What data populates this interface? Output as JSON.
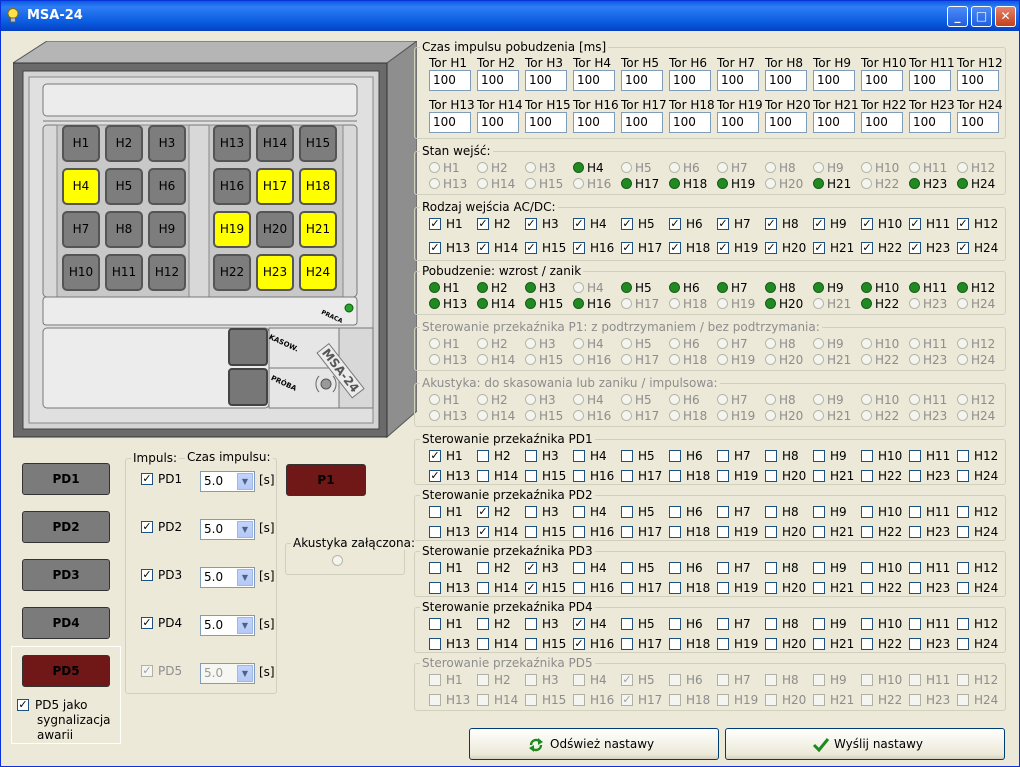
{
  "window": {
    "title": "MSA-24",
    "minimize": "_",
    "maximize": "□",
    "close": "✕"
  },
  "device": {
    "logo": "MSA-24",
    "praca": "PRACA",
    "kasow": "KASOW.",
    "proba": "PRÓBA",
    "left_buttons": [
      {
        "label": "H1",
        "on": false
      },
      {
        "label": "H2",
        "on": false
      },
      {
        "label": "H3",
        "on": false
      },
      {
        "label": "H4",
        "on": true
      },
      {
        "label": "H5",
        "on": false
      },
      {
        "label": "H6",
        "on": false
      },
      {
        "label": "H7",
        "on": false
      },
      {
        "label": "H8",
        "on": false
      },
      {
        "label": "H9",
        "on": false
      },
      {
        "label": "H10",
        "on": false
      },
      {
        "label": "H11",
        "on": false
      },
      {
        "label": "H12",
        "on": false
      }
    ],
    "right_buttons": [
      {
        "label": "H13",
        "on": false
      },
      {
        "label": "H14",
        "on": false
      },
      {
        "label": "H15",
        "on": false
      },
      {
        "label": "H16",
        "on": false
      },
      {
        "label": "H17",
        "on": true
      },
      {
        "label": "H18",
        "on": true
      },
      {
        "label": "H19",
        "on": true
      },
      {
        "label": "H20",
        "on": false
      },
      {
        "label": "H21",
        "on": true
      },
      {
        "label": "H22",
        "on": false
      },
      {
        "label": "H23",
        "on": true
      },
      {
        "label": "H24",
        "on": true
      }
    ]
  },
  "pd_buttons": [
    {
      "label": "PD1",
      "red": false
    },
    {
      "label": "PD2",
      "red": false
    },
    {
      "label": "PD3",
      "red": false
    },
    {
      "label": "PD4",
      "red": false
    },
    {
      "label": "PD5",
      "red": true
    }
  ],
  "impuls": {
    "impuls_label": "Impuls:",
    "czas_label": "Czas impulsu:",
    "unit": "[s]",
    "rows": [
      {
        "label": "PD1",
        "checked": true,
        "value": "5.0",
        "disabled": false
      },
      {
        "label": "PD2",
        "checked": true,
        "value": "5.0",
        "disabled": false
      },
      {
        "label": "PD3",
        "checked": true,
        "value": "5.0",
        "disabled": false
      },
      {
        "label": "PD4",
        "checked": true,
        "value": "5.0",
        "disabled": false
      },
      {
        "label": "PD5",
        "checked": true,
        "value": "5.0",
        "disabled": true
      }
    ]
  },
  "p1_button": "P1",
  "akustyka_zalaczona": "Akustyka załączona:",
  "pd5_alarm": {
    "line1": "PD5 jako",
    "line2": "sygnalizacja",
    "line3": "awarii",
    "checked": true
  },
  "czas_impulsu": {
    "title": "Czas impulsu pobudzenia [ms]",
    "tracks": [
      "Tor H1",
      "Tor H2",
      "Tor H3",
      "Tor H4",
      "Tor H5",
      "Tor H6",
      "Tor H7",
      "Tor H8",
      "Tor H9",
      "Tor H10",
      "Tor H11",
      "Tor H12",
      "Tor H13",
      "Tor H14",
      "Tor H15",
      "Tor H16",
      "Tor H17",
      "Tor H18",
      "Tor H19",
      "Tor H20",
      "Tor H21",
      "Tor H22",
      "Tor H23",
      "Tor H24"
    ],
    "values": [
      "100",
      "100",
      "100",
      "100",
      "100",
      "100",
      "100",
      "100",
      "100",
      "100",
      "100",
      "100",
      "100",
      "100",
      "100",
      "100",
      "100",
      "100",
      "100",
      "100",
      "100",
      "100",
      "100",
      "100"
    ]
  },
  "channels": [
    "H1",
    "H2",
    "H3",
    "H4",
    "H5",
    "H6",
    "H7",
    "H8",
    "H9",
    "H10",
    "H11",
    "H12",
    "H13",
    "H14",
    "H15",
    "H16",
    "H17",
    "H18",
    "H19",
    "H20",
    "H21",
    "H22",
    "H23",
    "H24"
  ],
  "groups": [
    {
      "title": "Stan wejść:",
      "kind": "radio",
      "disabled": false,
      "on": [
        4,
        17,
        18,
        19,
        21,
        23,
        24
      ],
      "dis": [
        1,
        2,
        3,
        5,
        6,
        7,
        8,
        9,
        10,
        11,
        12,
        13,
        14,
        15,
        16,
        20,
        22
      ]
    },
    {
      "title": "Rodzaj wejścia AC/DC:",
      "kind": "check",
      "disabled": false,
      "on": [
        1,
        2,
        3,
        4,
        5,
        6,
        7,
        8,
        9,
        10,
        11,
        12,
        13,
        14,
        15,
        16,
        17,
        18,
        19,
        20,
        21,
        22,
        23,
        24
      ],
      "dis": []
    },
    {
      "title": "Pobudzenie:  wzrost / zanik",
      "kind": "radio",
      "disabled": false,
      "on": [
        1,
        2,
        3,
        5,
        6,
        7,
        8,
        9,
        10,
        11,
        12,
        13,
        14,
        15,
        16,
        20,
        22
      ],
      "dis": [
        4,
        17,
        18,
        19,
        21,
        23,
        24
      ]
    },
    {
      "title": "Sterowanie przekaźnika P1:  z podtrzymaniem / bez podtrzymania:",
      "kind": "radio",
      "disabled": true,
      "on": [],
      "dis": [
        1,
        2,
        3,
        4,
        5,
        6,
        7,
        8,
        9,
        10,
        11,
        12,
        13,
        14,
        15,
        16,
        17,
        18,
        19,
        20,
        21,
        22,
        23,
        24
      ]
    },
    {
      "title": "Akustyka: do skasowania lub zaniku / impulsowa:",
      "kind": "radio",
      "disabled": true,
      "on": [],
      "dis": [
        1,
        2,
        3,
        4,
        5,
        6,
        7,
        8,
        9,
        10,
        11,
        12,
        13,
        14,
        15,
        16,
        17,
        18,
        19,
        20,
        21,
        22,
        23,
        24
      ]
    },
    {
      "title": "Sterowanie przekaźnika PD1",
      "kind": "check",
      "disabled": false,
      "on": [
        1,
        13
      ],
      "dis": []
    },
    {
      "title": "Sterowanie przekaźnika PD2",
      "kind": "check",
      "disabled": false,
      "on": [
        2,
        14
      ],
      "dis": []
    },
    {
      "title": "Sterowanie przekaźnika PD3",
      "kind": "check",
      "disabled": false,
      "on": [
        3,
        15
      ],
      "dis": []
    },
    {
      "title": "Sterowanie przekaźnika PD4",
      "kind": "check",
      "disabled": false,
      "on": [
        4,
        16
      ],
      "dis": []
    },
    {
      "title": "Sterowanie przekaźnika PD5",
      "kind": "check",
      "disabled": true,
      "on": [
        5,
        17
      ],
      "dis": [
        1,
        2,
        3,
        4,
        5,
        6,
        7,
        8,
        9,
        10,
        11,
        12,
        13,
        14,
        15,
        16,
        17,
        18,
        19,
        20,
        21,
        22,
        23,
        24
      ]
    }
  ],
  "bottom_buttons": {
    "refresh": "Odśwież nastawy",
    "send": "Wyślij nastawy"
  },
  "colors": {
    "led_on": "#1f8a1f",
    "lamp_on": "#ffff00",
    "pd5_red": "#701818",
    "title_bar": "#0a5ce0"
  }
}
